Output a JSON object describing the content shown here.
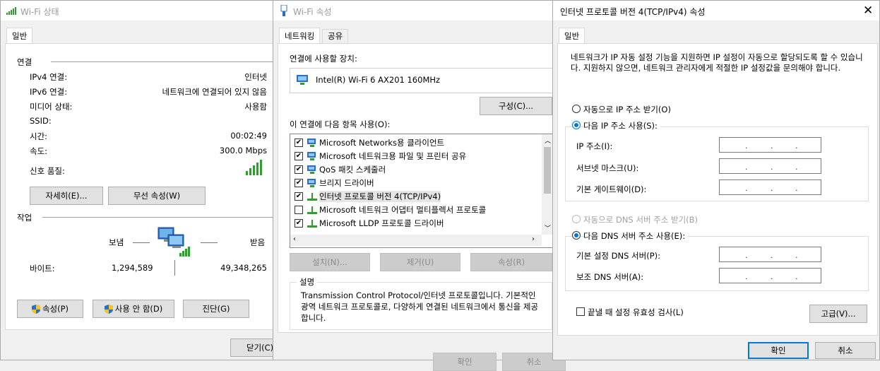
{
  "status_window": {
    "title": "Wi-Fi 상태",
    "tab": "일반",
    "connection_header": "연결",
    "rows": [
      {
        "label": "IPv4 연결:",
        "value": "인터넷"
      },
      {
        "label": "IPv6 연결:",
        "value": "네트워크에 연결되어 있지 않음"
      },
      {
        "label": "미디어 상태:",
        "value": "사용함"
      },
      {
        "label": "SSID:",
        "value": ""
      },
      {
        "label": "시간:",
        "value": "00:02:49"
      },
      {
        "label": "속도:",
        "value": "300.0 Mbps"
      }
    ],
    "signal_label": "신호 품질:",
    "details_button": "자세히(E)...",
    "wireless_props_button": "무선 속성(W)",
    "activity_header": "작업",
    "sent_label": "보냄",
    "received_label": "받음",
    "bytes_label": "바이트:",
    "bytes_sent": "1,294,589",
    "bytes_received": "49,348,265",
    "properties_button": "속성(P)",
    "disable_button": "사용 안 함(D)",
    "diagnose_button": "진단(G)",
    "close_button": "닫기(C)"
  },
  "props_window": {
    "title": "Wi-Fi 속성",
    "tabs": [
      "네트워킹",
      "공유"
    ],
    "connect_using_label": "연결에 사용할 장치:",
    "adapter": "Intel(R) Wi-Fi 6 AX201 160MHz",
    "configure_button": "구성(C)...",
    "items_label": "이 연결에 다음 항목 사용(O):",
    "items": [
      {
        "label": "Microsoft Networks용 클라이언트",
        "checked": true,
        "icon": "network-client-icon"
      },
      {
        "label": "Microsoft 네트워크용 파일 및 프린터 공유",
        "checked": true,
        "icon": "network-client-icon"
      },
      {
        "label": "QoS 패킷 스케줄러",
        "checked": true,
        "icon": "network-client-icon"
      },
      {
        "label": "브리지 드라이버",
        "checked": true,
        "icon": "network-client-icon"
      },
      {
        "label": "인터넷 프로토콜 버전 4(TCP/IPv4)",
        "checked": true,
        "icon": "protocol-icon"
      },
      {
        "label": "Microsoft 네트워크 어댑터 멀티플렉서 프로토콜",
        "checked": false,
        "icon": "protocol-icon"
      },
      {
        "label": "Microsoft LLDP 프로토콜 드라이버",
        "checked": true,
        "icon": "protocol-icon"
      }
    ],
    "install_button": "설치(N)...",
    "uninstall_button": "제거(U)",
    "properties_button": "속성(R)",
    "description_header": "설명",
    "description": "Transmission Control Protocol/인터넷 프로토콜입니다. 기본적인 광역 네트워크 프로토콜로, 다양하게 연결된 네트워크에서 통신을 제공합니다.",
    "ok_button": "확인",
    "cancel_button": "취소"
  },
  "ipv4_window": {
    "title": "인터넷 프로토콜 버전 4(TCP/IPv4) 속성",
    "tab": "일반",
    "intro": "네트워크가 IP 자동 설정 기능을 지원하면 IP 설정이 자동으로 할당되도록 할 수 있습니다. 지원하지 않으면, 네트워크 관리자에게 적절한 IP 설정값을 문의해야 합니다.",
    "auto_ip": "자동으로 IP 주소 받기(O)",
    "manual_ip": "다음 IP 주소 사용(S):",
    "ip_label": "IP 주소(I):",
    "subnet_label": "서브넷 마스크(U):",
    "gateway_label": "기본 게이트웨이(D):",
    "auto_dns": "자동으로 DNS 서버 주소 받기(B)",
    "manual_dns": "다음 DNS 서버 주소 사용(E):",
    "preferred_dns_label": "기본 설정 DNS 서버(P):",
    "alternate_dns_label": "보조 DNS 서버(A):",
    "validate_label": "끝낼 때 설정 유효성 검사(L)",
    "advanced_button": "고급(V)...",
    "ok_button": "확인",
    "cancel_button": "취소"
  },
  "colors": {
    "accent": "#0078d7",
    "signal": "#2e9e2e"
  }
}
